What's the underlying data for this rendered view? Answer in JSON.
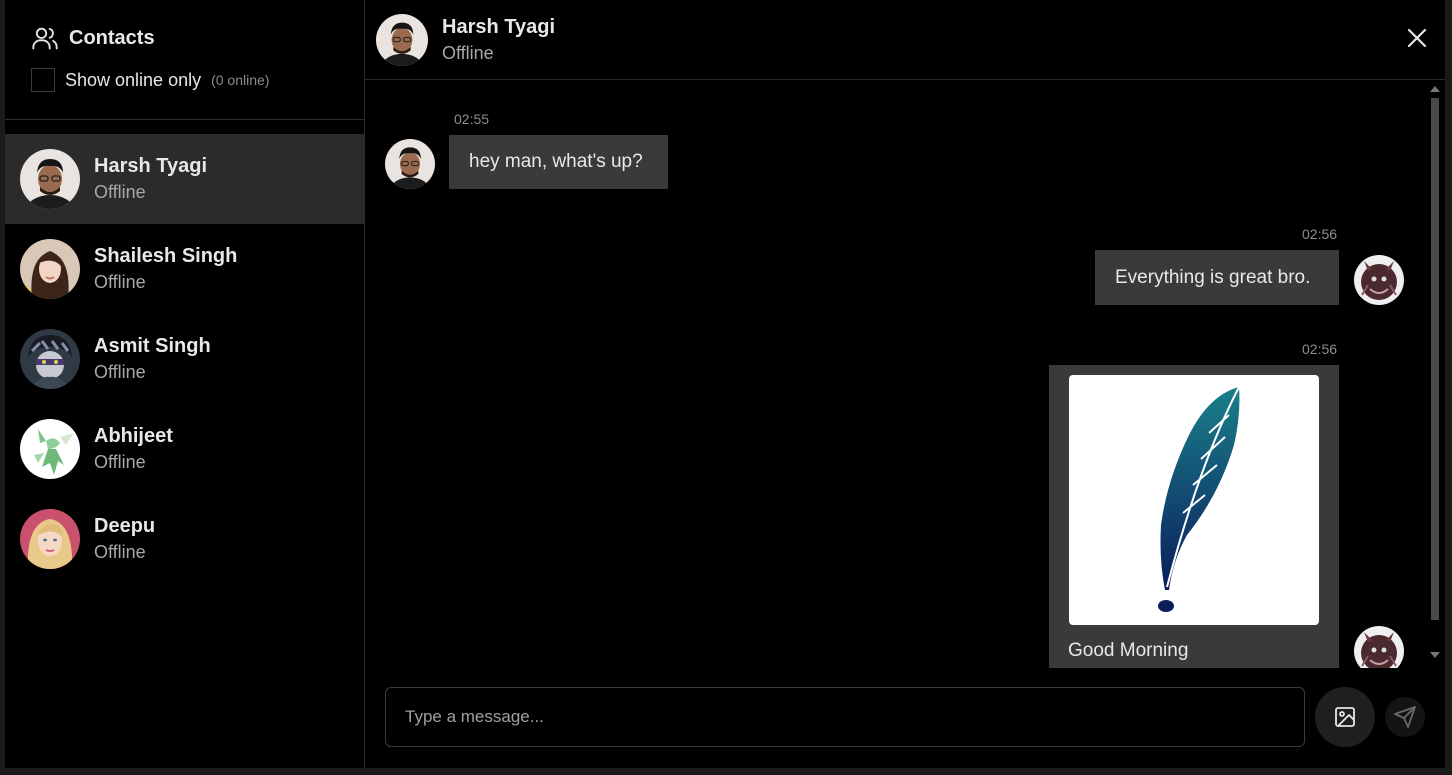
{
  "sidebar": {
    "title": "Contacts",
    "filter_label": "Show online only",
    "online_count": "(0 online)",
    "contacts": [
      {
        "name": "Harsh Tyagi",
        "status": "Offline"
      },
      {
        "name": "Shailesh Singh",
        "status": "Offline"
      },
      {
        "name": "Asmit Singh",
        "status": "Offline"
      },
      {
        "name": "Abhijeet",
        "status": "Offline"
      },
      {
        "name": "Deepu",
        "status": "Offline"
      }
    ]
  },
  "chat": {
    "name": "Harsh Tyagi",
    "status": "Offline",
    "messages": [
      {
        "time": "02:55",
        "text": "hey man, what's up?"
      },
      {
        "time": "02:56",
        "text": "Everything is great bro."
      },
      {
        "time": "02:56",
        "caption": "Good Morning"
      }
    ],
    "input_placeholder": "Type a message..."
  }
}
